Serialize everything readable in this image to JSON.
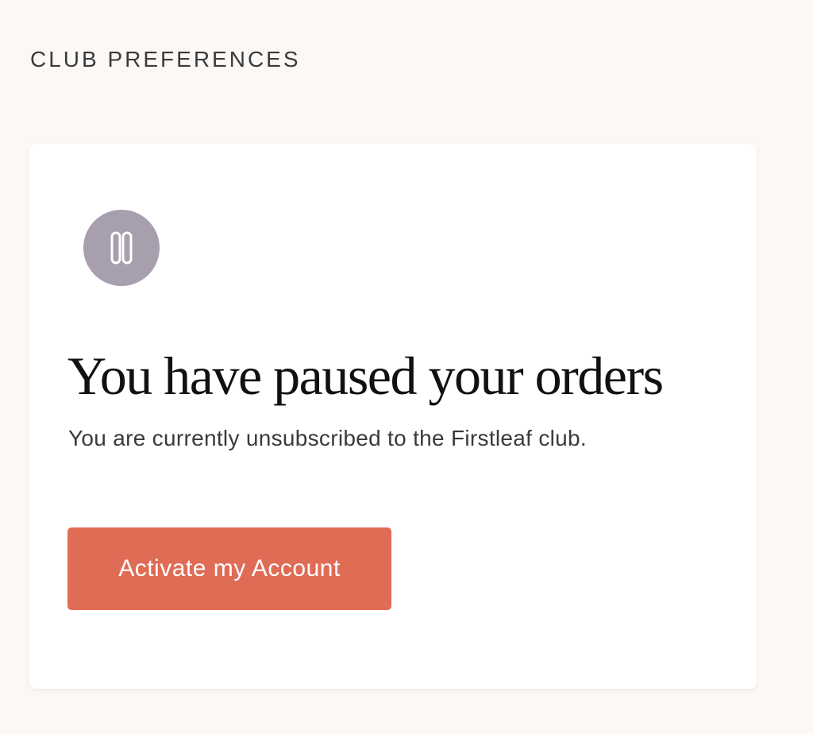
{
  "page": {
    "section_heading": "CLUB PREFERENCES"
  },
  "status_card": {
    "icon": "pause-icon",
    "title": "You have paused your orders",
    "subtitle": "You are currently unsubscribed to the Firstleaf club.",
    "button_label": "Activate my Account"
  },
  "colors": {
    "page_background": "#fbf8f6",
    "card_background": "#ffffff",
    "icon_circle": "#a79fae",
    "button_background": "#df6c55",
    "button_text": "#ffffff",
    "title_text": "#111111",
    "subtitle_text": "#3a3a3a"
  }
}
